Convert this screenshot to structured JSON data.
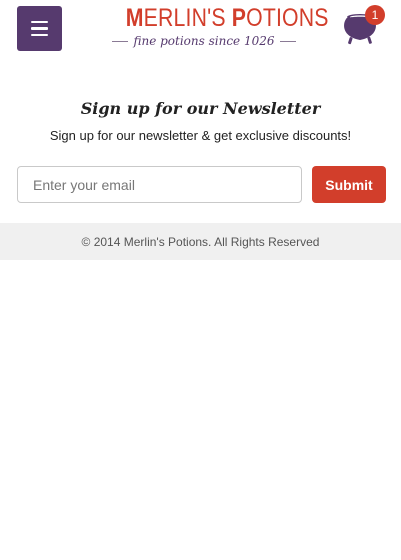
{
  "header": {
    "menu_icon": "hamburger-icon",
    "logo_title": "MERLIN'S POTIONS",
    "logo_title_parts": [
      "M",
      "ERLIN'S ",
      "P",
      "OTIONS"
    ],
    "logo_tagline": "fine potions since 1026",
    "cart_icon": "cauldron-icon",
    "cart_count": "1"
  },
  "newsletter": {
    "title": "Sign up for our Newsletter",
    "description": "Sign up for our newsletter & get exclusive discounts!",
    "email_placeholder": "Enter your email",
    "email_value": "",
    "submit_label": "Submit"
  },
  "footer": {
    "copyright": "© 2014 Merlin's Potions. All Rights Reserved"
  },
  "colors": {
    "brand_purple": "#563a6e",
    "brand_red": "#d23e2b",
    "footer_bg": "#f0f0f0"
  }
}
